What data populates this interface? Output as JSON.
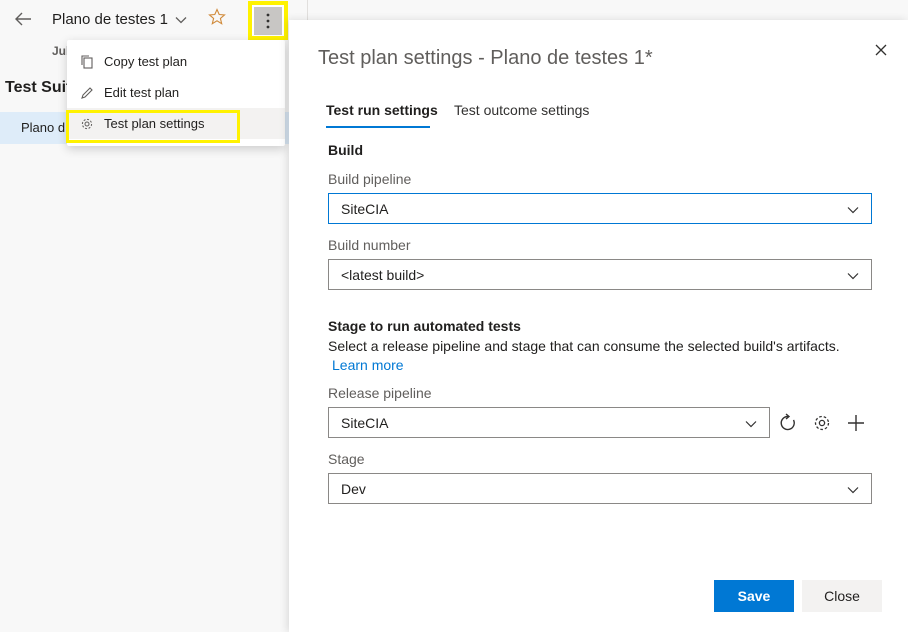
{
  "left": {
    "plan_title": "Plano de testes 1",
    "date_partial": "Jul",
    "suites_heading": "Test Suit",
    "suite_item": "Plano d"
  },
  "menu": {
    "items": [
      {
        "label": "Copy test plan",
        "icon": "copy-icon"
      },
      {
        "label": "Edit test plan",
        "icon": "pencil-icon"
      },
      {
        "label": "Test plan settings",
        "icon": "gear-icon"
      }
    ]
  },
  "panel": {
    "title": "Test plan settings - Plano de testes 1*",
    "tabs": [
      "Test run settings",
      "Test outcome settings"
    ],
    "build": {
      "heading": "Build",
      "pipeline_label": "Build pipeline",
      "pipeline_value": "SiteCIA",
      "number_label": "Build number",
      "number_value": "<latest build>"
    },
    "stage": {
      "heading": "Stage to run automated tests",
      "description": "Select a release pipeline and stage that can consume the selected build's artifacts.",
      "learn_more": "Learn more",
      "release_label": "Release pipeline",
      "release_value": "SiteCIA",
      "stage_label": "Stage",
      "stage_value": "Dev"
    },
    "save_label": "Save",
    "close_label": "Close"
  },
  "colors": {
    "accent": "#0078d4",
    "highlight": "#fff200",
    "star": "#d08a3a",
    "selected_row": "#deecf9"
  }
}
